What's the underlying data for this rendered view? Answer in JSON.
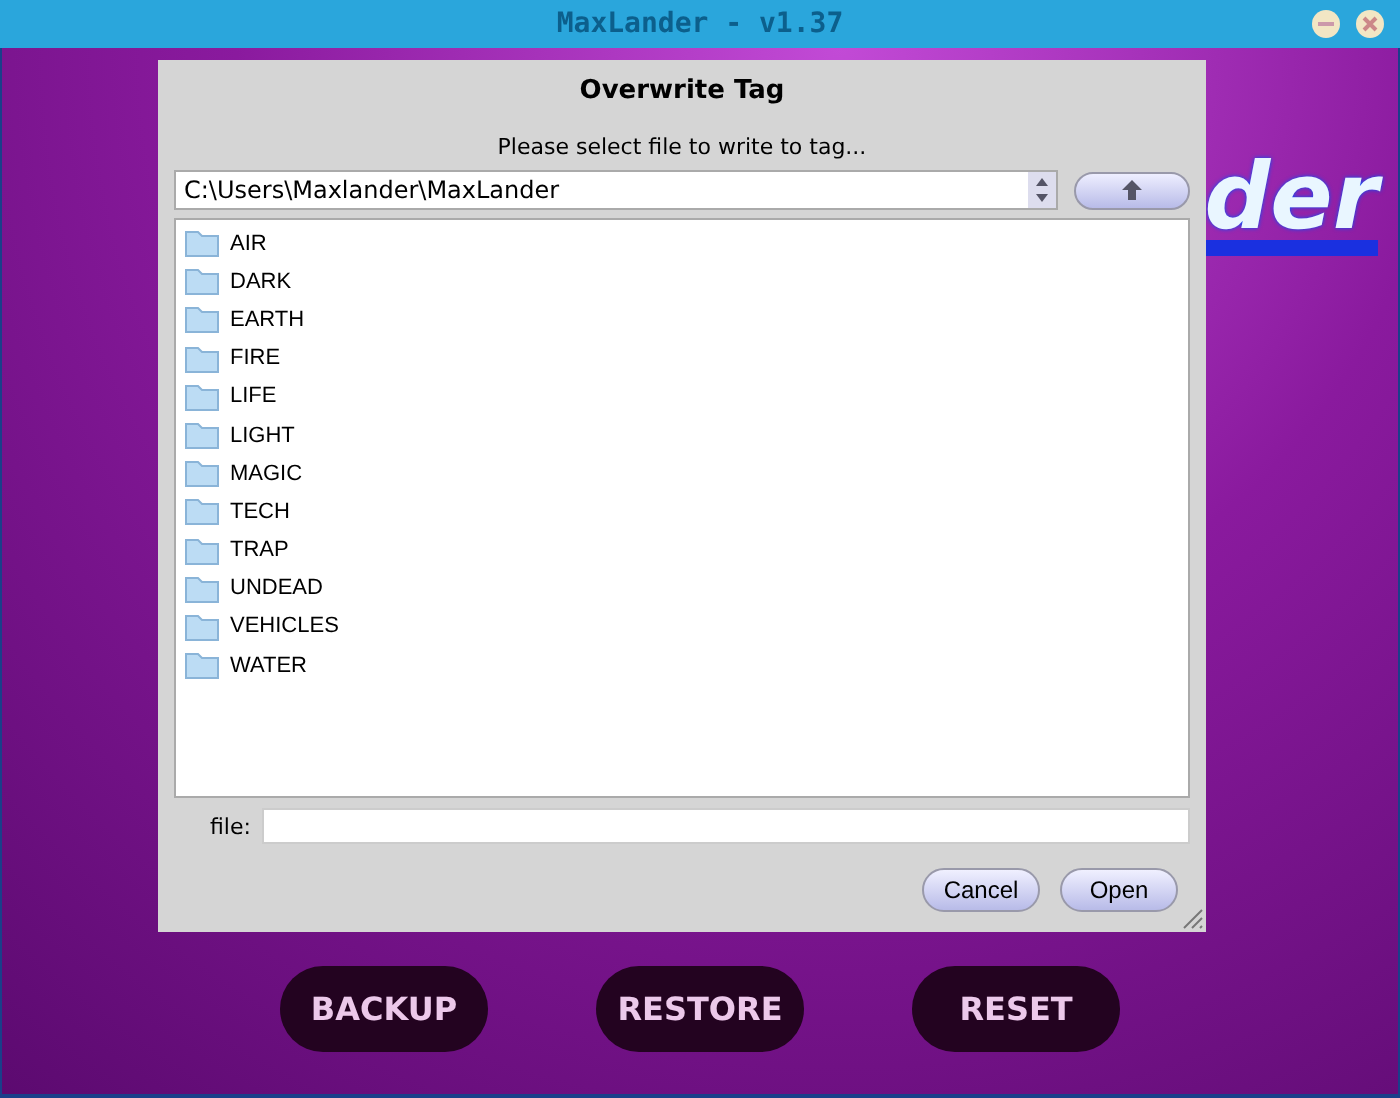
{
  "window": {
    "title": "MaxLander - v1.37"
  },
  "logo_fragment": "der",
  "dialog": {
    "title": "Overwrite Tag",
    "prompt": "Please select file to write to tag...",
    "path": "C:\\Users\\Maxlander\\MaxLander",
    "folders": [
      "AIR",
      "DARK",
      "EARTH",
      "FIRE",
      "LIFE",
      "LIGHT",
      "MAGIC",
      "TECH",
      "TRAP",
      "UNDEAD",
      "VEHICLES",
      "WATER"
    ],
    "file_label": "file:",
    "buttons": [
      "Cancel",
      "Open"
    ]
  },
  "actions": [
    "BACKUP",
    "RESTORE",
    "RESET"
  ]
}
